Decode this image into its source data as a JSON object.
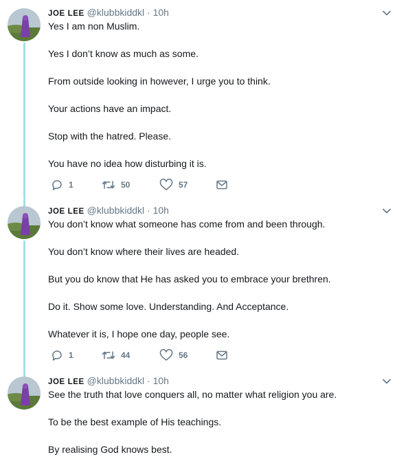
{
  "tweets": [
    {
      "author_name": "JOE LEE",
      "handle": "@klubbkiddkl",
      "time": "10h",
      "lines": [
        "Yes I am non Muslim.",
        "Yes I don’t know as much as some.",
        "From outside looking in however, I urge you to think.",
        "Your actions have an impact.",
        "Stop with the hatred. Please.",
        "You have no idea how disturbing it is."
      ],
      "replies": "1",
      "retweets": "50",
      "likes": "57"
    },
    {
      "author_name": "JOE LEE",
      "handle": "@klubbkiddkl",
      "time": "10h",
      "lines": [
        "You don’t know what someone has come from and been through.",
        "You don’t know where their lives are headed.",
        "But you do know that He has asked you to embrace your brethren.",
        "Do it. Show some love. Understanding. And Acceptance.",
        "Whatever it is, I hope one day, people see."
      ],
      "replies": "1",
      "retweets": "44",
      "likes": "56"
    },
    {
      "author_name": "JOE LEE",
      "handle": "@klubbkiddkl",
      "time": "10h",
      "lines": [
        "See the truth that love conquers all, no matter what religion you are.",
        "To be the best example of His teachings.",
        "By realising God knows best."
      ]
    }
  ],
  "dot_separator": "·",
  "colors": {
    "thread_line": "#a0dfe8",
    "text": "#14171a",
    "muted": "#657786"
  },
  "icons": [
    "reply-icon",
    "retweet-icon",
    "like-icon",
    "direct-message-icon",
    "chevron-down-icon"
  ]
}
